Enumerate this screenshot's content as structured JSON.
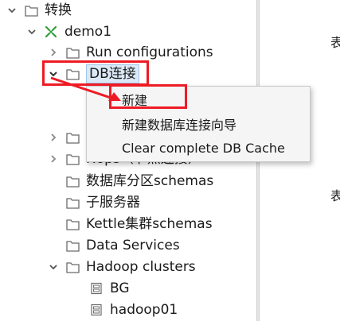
{
  "tree": {
    "root": {
      "label": "转换"
    },
    "job": {
      "label": "demo1"
    },
    "run_configurations": {
      "label": "Run configurations"
    },
    "db_connections": {
      "label": "DB连接"
    },
    "partially_hidden_1": {
      "label": ""
    },
    "hops": {
      "label": "Hops（节点连接）"
    },
    "partition_schemas": {
      "label": "数据库分区schemas"
    },
    "slave_servers": {
      "label": "子服务器"
    },
    "kettle_cluster_schemas": {
      "label": "Kettle集群schemas"
    },
    "data_services": {
      "label": "Data Services"
    },
    "hadoop_clusters": {
      "label": "Hadoop clusters"
    },
    "hadoop_children": [
      {
        "label": "BG"
      },
      {
        "label": "hadoop01"
      }
    ]
  },
  "context_menu": {
    "items": [
      {
        "label": "新建"
      },
      {
        "label": "新建数据库连接向导"
      },
      {
        "label": "Clear complete DB Cache"
      }
    ]
  },
  "right_pane": {
    "fragments": [
      "表",
      "表"
    ]
  },
  "colors": {
    "highlight_red": "#ee1b24",
    "selection_bg": "#dbe9f7",
    "job_icon_green": "#2e9e3a"
  }
}
